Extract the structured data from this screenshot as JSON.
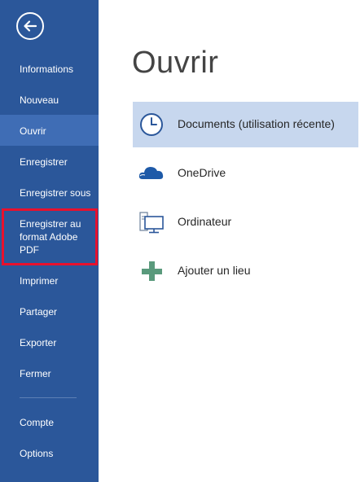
{
  "nav": {
    "back_label": "Retour",
    "items": [
      {
        "label": "Informations"
      },
      {
        "label": "Nouveau"
      },
      {
        "label": "Ouvrir"
      },
      {
        "label": "Enregistrer"
      },
      {
        "label": "Enregistrer sous"
      },
      {
        "label": "Enregistrer au format Adobe PDF"
      },
      {
        "label": "Imprimer"
      },
      {
        "label": "Partager"
      },
      {
        "label": "Exporter"
      },
      {
        "label": "Fermer"
      },
      {
        "label": "Compte"
      },
      {
        "label": "Options"
      }
    ],
    "selected": "Ouvrir"
  },
  "main": {
    "title": "Ouvrir",
    "locations": [
      {
        "label": "Documents (utilisation récente)",
        "icon": "clock-icon"
      },
      {
        "label": "OneDrive",
        "icon": "cloud-icon"
      },
      {
        "label": "Ordinateur",
        "icon": "computer-icon"
      },
      {
        "label": "Ajouter un lieu",
        "icon": "plus-icon"
      }
    ]
  },
  "colors": {
    "sidebar": "#2b579a",
    "selected_nav": "#3f6db5",
    "active_location": "#c7d7ee",
    "highlight_border": "#e8112d"
  }
}
